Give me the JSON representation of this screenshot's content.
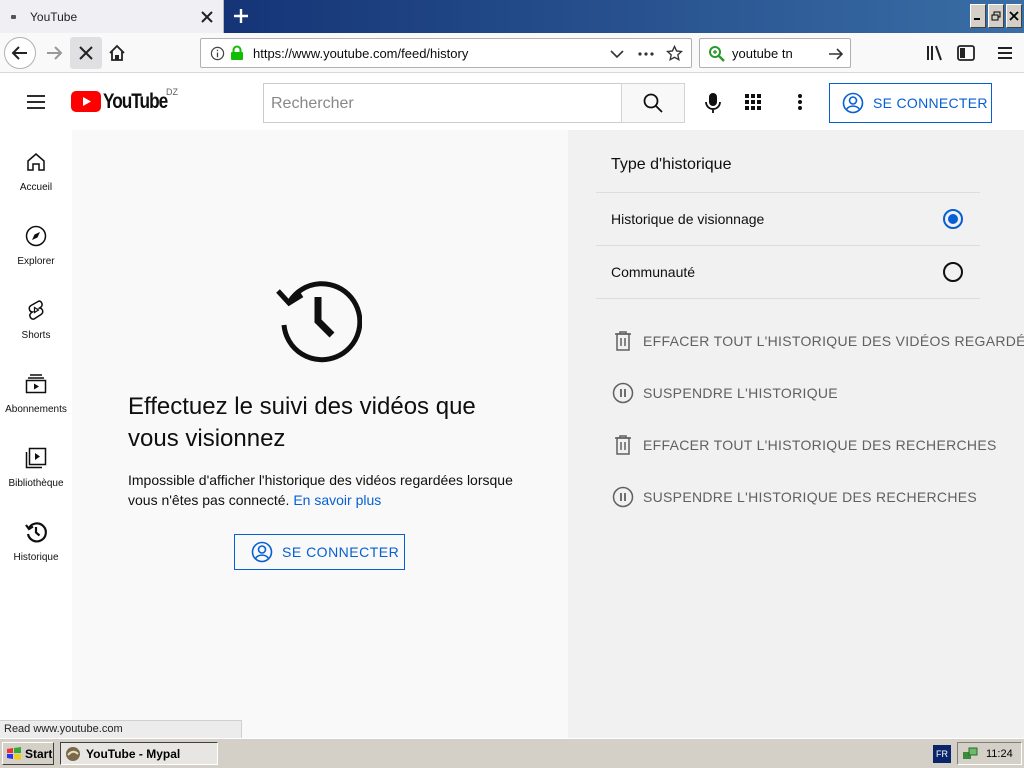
{
  "browser": {
    "tab_title": "YouTube",
    "url": "https://www.youtube.com/feed/history",
    "search_query": "youtube tn",
    "status_text": "Read www.youtube.com"
  },
  "youtube": {
    "logo_text": "YouTube",
    "region": "DZ",
    "search_placeholder": "Rechercher",
    "signin_label": "SE CONNECTER",
    "sidebar": [
      {
        "label": "Accueil",
        "icon": "home-icon"
      },
      {
        "label": "Explorer",
        "icon": "compass-icon"
      },
      {
        "label": "Shorts",
        "icon": "shorts-icon"
      },
      {
        "label": "Abonnements",
        "icon": "subscriptions-icon"
      },
      {
        "label": "Bibliothèque",
        "icon": "library-icon"
      },
      {
        "label": "Historique",
        "icon": "history-icon"
      }
    ],
    "main": {
      "headline": "Effectuez le suivi des vidéos que vous visionnez",
      "description": "Impossible d'afficher l'historique des vidéos regardées lorsque vous n'êtes pas connecté.",
      "learn_more": "En savoir plus",
      "signin_label": "SE CONNECTER"
    },
    "history_panel": {
      "title": "Type d'historique",
      "options": [
        {
          "label": "Historique de visionnage",
          "selected": true
        },
        {
          "label": "Communauté",
          "selected": false
        }
      ],
      "actions": [
        {
          "label": "EFFACER TOUT L'HISTORIQUE DES VIDÉOS REGARDÉES",
          "icon": "trash-icon"
        },
        {
          "label": "SUSPENDRE L'HISTORIQUE",
          "icon": "pause-icon"
        },
        {
          "label": "EFFACER TOUT L'HISTORIQUE DES RECHERCHES",
          "icon": "trash-icon"
        },
        {
          "label": "SUSPENDRE L'HISTORIQUE DES RECHERCHES",
          "icon": "pause-icon"
        }
      ]
    }
  },
  "taskbar": {
    "start_label": "Start",
    "task_label": "YouTube - Mypal",
    "language": "FR",
    "clock": "11:24"
  },
  "colors": {
    "accent_blue": "#065fd4",
    "youtube_red": "#ff0000"
  }
}
